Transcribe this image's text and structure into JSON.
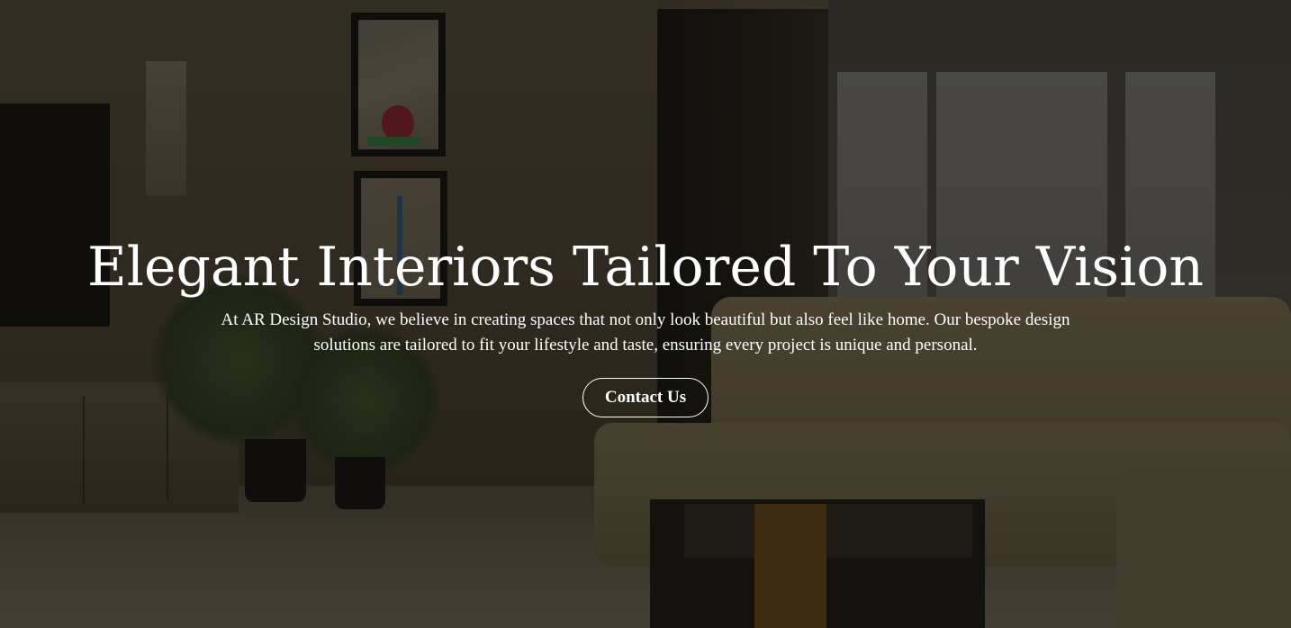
{
  "hero": {
    "headline": "Elegant Interiors Tailored To Your Vision",
    "subtext": "At AR Design Studio, we believe in creating spaces that not only look beautiful but also feel like home. Our bespoke design solutions are tailored to fit your lifestyle and taste, ensuring every project is unique and personal.",
    "cta_label": "Contact Us"
  },
  "colors": {
    "text": "#ffffff",
    "overlay": "#0a0805"
  }
}
